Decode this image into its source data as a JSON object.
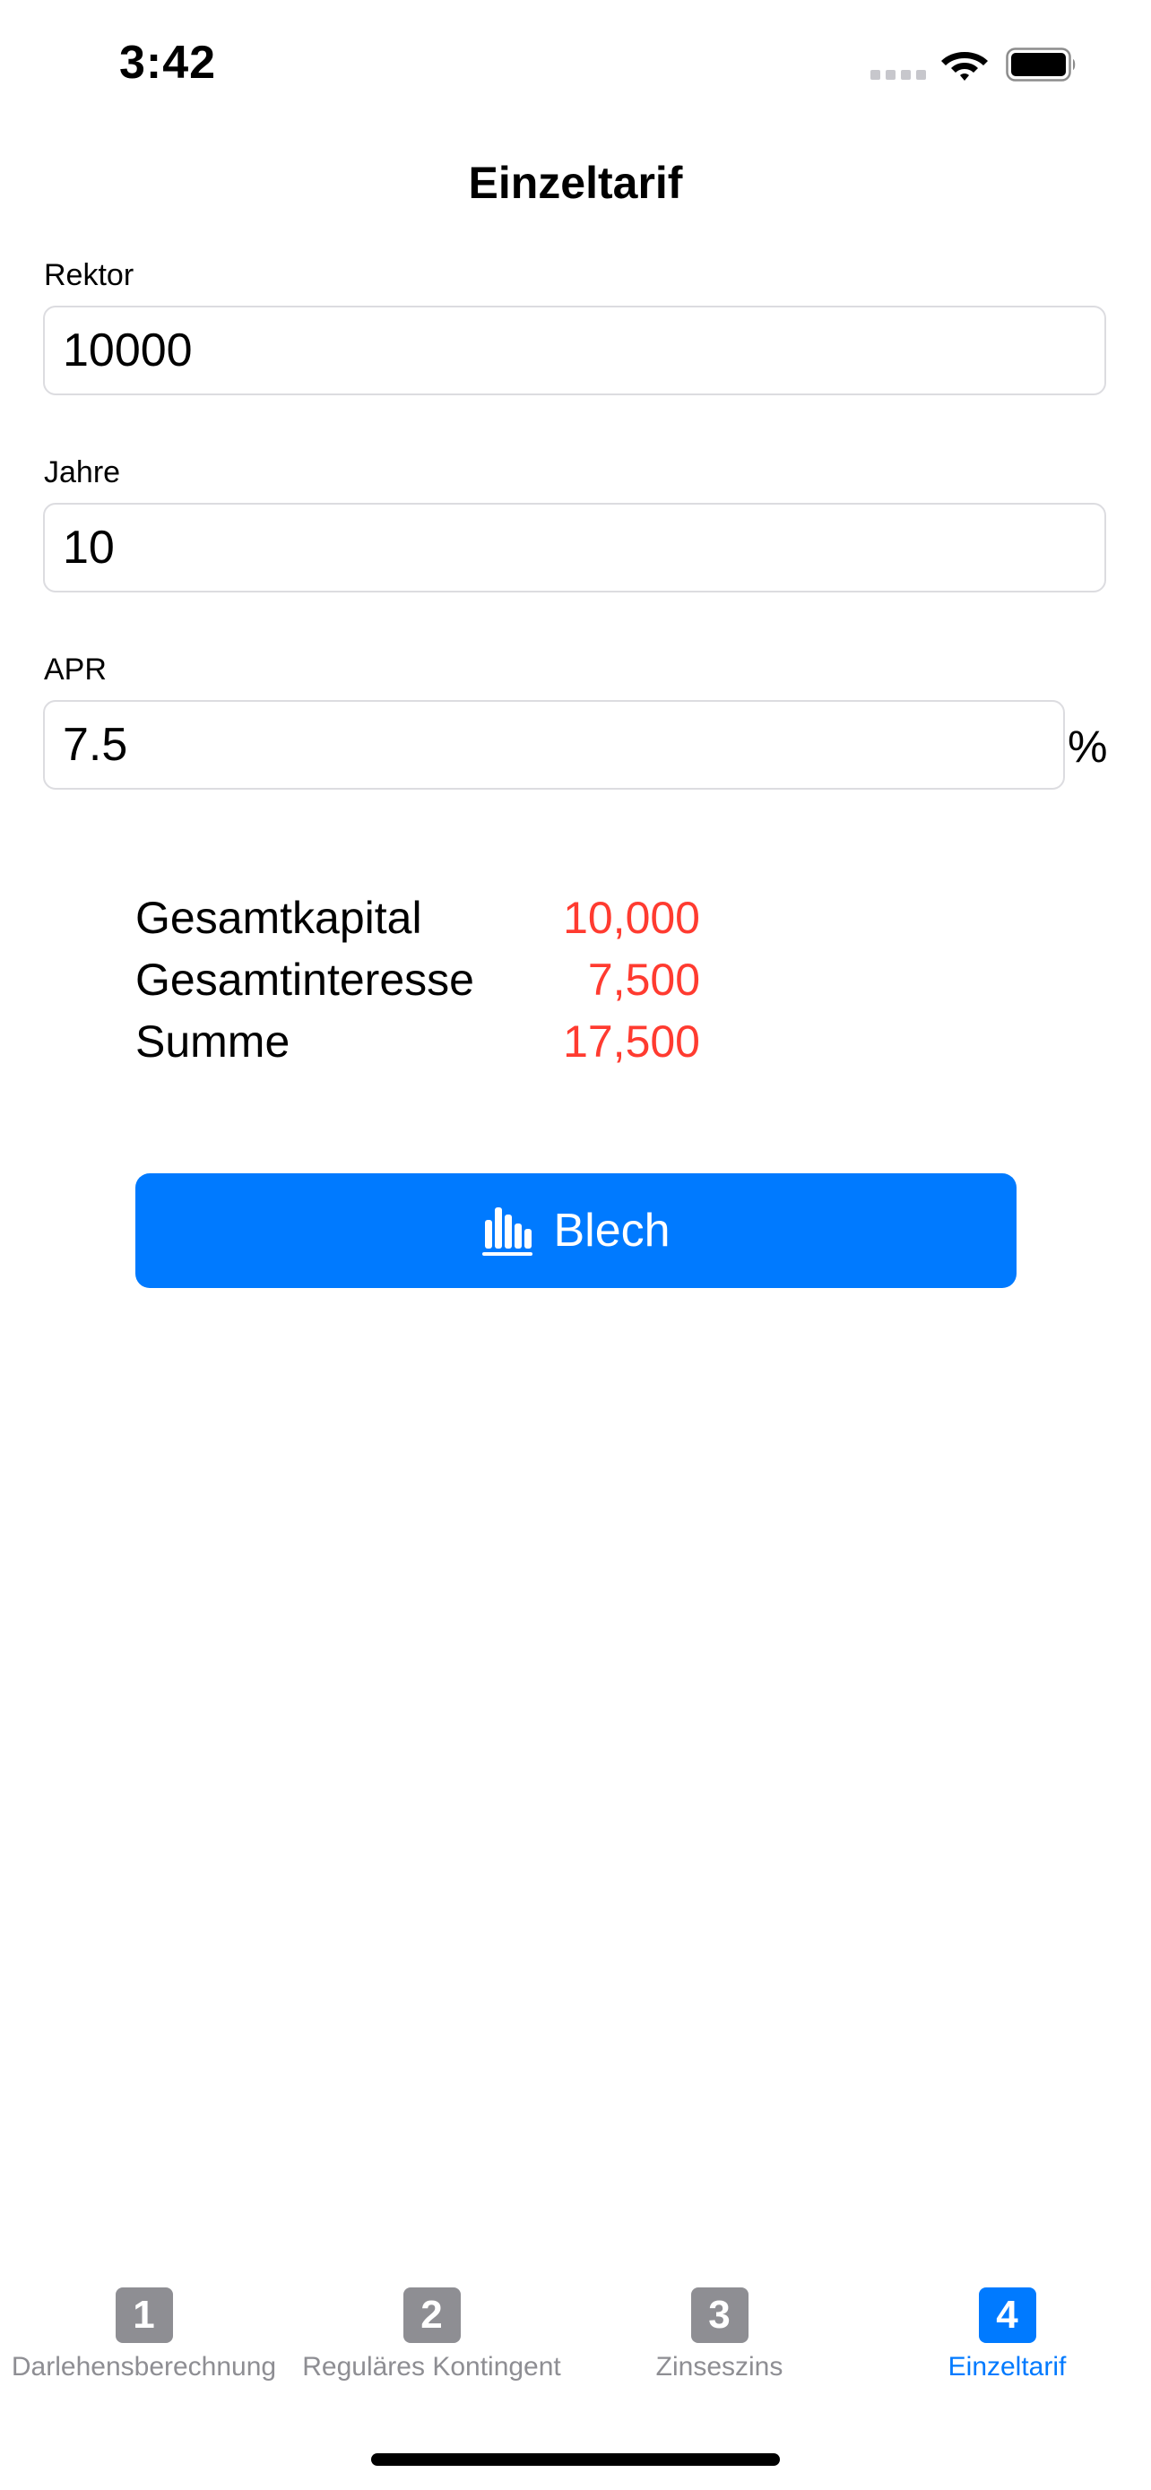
{
  "status_bar": {
    "time": "3:42"
  },
  "nav": {
    "title": "Einzeltarif"
  },
  "form": {
    "principal": {
      "label": "Rektor",
      "value": "10000"
    },
    "years": {
      "label": "Jahre",
      "value": "10"
    },
    "apr": {
      "label": "APR",
      "value": "7.5",
      "suffix": "%"
    }
  },
  "results": [
    {
      "label": "Gesamtkapital",
      "value": "10,000"
    },
    {
      "label": "Gesamtinteresse",
      "value": "7,500"
    },
    {
      "label": "Summe",
      "value": "17,500"
    }
  ],
  "chart_button": {
    "label": "Blech",
    "icon": "bar-chart-icon"
  },
  "tab_bar": {
    "tabs": [
      {
        "number": "1",
        "label": "Darlehensberechnung",
        "active": false
      },
      {
        "number": "2",
        "label": "Reguläres Kontingent",
        "active": false
      },
      {
        "number": "3",
        "label": "Zinseszins",
        "active": false
      },
      {
        "number": "4",
        "label": "Einzeltarif",
        "active": true
      }
    ]
  },
  "colors": {
    "accent": "#007aff",
    "result_value": "#ff3b30",
    "inactive_tab": "#8e8e93"
  }
}
